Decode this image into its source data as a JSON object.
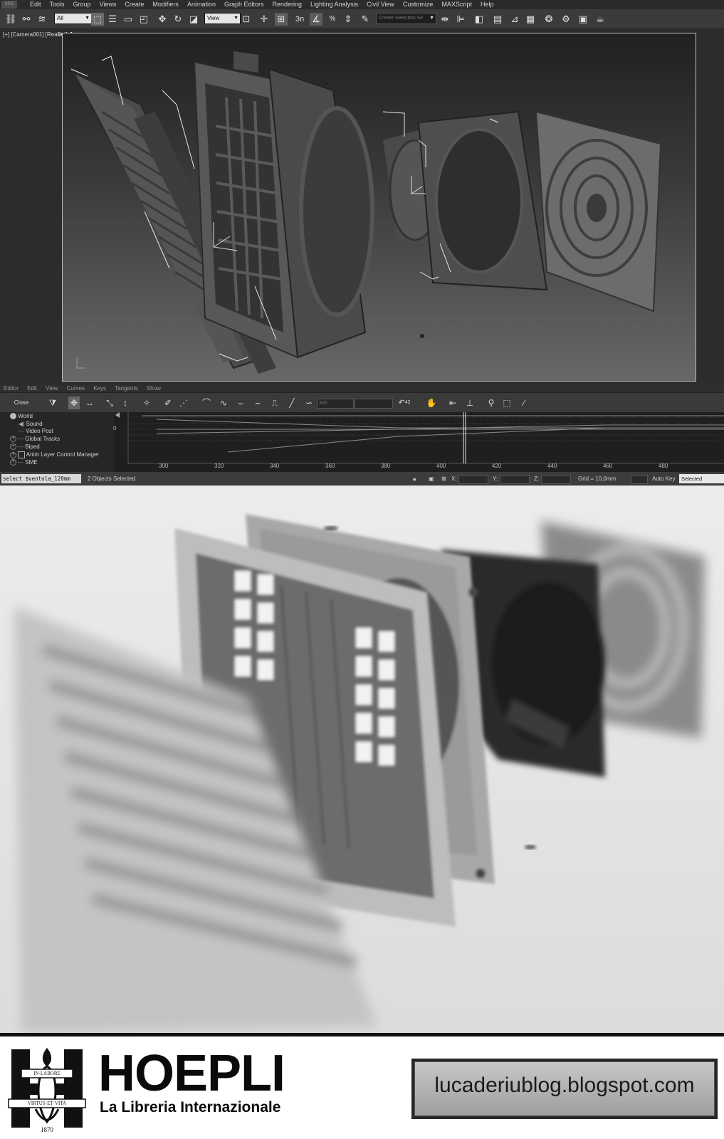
{
  "menu": {
    "items": [
      "Edit",
      "Tools",
      "Group",
      "Views",
      "Create",
      "Modifiers",
      "Animation",
      "Graph Editors",
      "Rendering",
      "Lighting Analysis",
      "Civil View",
      "Customize",
      "MAXScript",
      "Help"
    ]
  },
  "toolbar": {
    "selection_filter": "All",
    "reference_coord": "View",
    "selection_set_placeholder": "Create Selection Se",
    "icons": [
      "link-icon",
      "unlink-icon",
      "bind-space-warp-icon",
      "select-object-icon",
      "select-by-name-icon",
      "rect-region-icon",
      "window-crossing-icon",
      "move-icon",
      "rotate-icon",
      "scale-icon",
      "pivot-icon",
      "snap-icon",
      "angle-snap-icon",
      "percent-snap-icon",
      "spinner-snap-icon",
      "edit-named-sets-icon",
      "mirror-icon",
      "align-icon",
      "layer-icon",
      "ribbon-icon",
      "curve-editor-icon",
      "schematic-icon",
      "material-editor-icon",
      "render-setup-icon",
      "rendered-frame-icon",
      "render-icon"
    ],
    "snap_label": "3n"
  },
  "viewport": {
    "label_prefix": "[+] [Camera001] [Rea",
    "label_suffix": "listic]"
  },
  "curve_editor": {
    "menu": [
      "Editor",
      "Edit",
      "View",
      "Curves",
      "Keys",
      "Tangents",
      "Show"
    ],
    "close_label": "Close",
    "frame_field": "300",
    "value_readout": "42",
    "tracks": [
      "World",
      "Sound",
      "Video Post",
      "Global Tracks",
      "Biped",
      "Anim Layer Control Manager",
      "SME"
    ],
    "value_zero": "0",
    "ruler": [
      "300",
      "320",
      "340",
      "360",
      "380",
      "400",
      "420",
      "440",
      "460",
      "480"
    ]
  },
  "status_bar": {
    "script_listener": "select $ventola_120mm",
    "selection_status": "2 Objects Selected",
    "x_label": "X:",
    "y_label": "Y:",
    "z_label": "Z:",
    "grid": "Grid = 10,0mm",
    "auto_key": "Auto Key",
    "selected": "Selected"
  },
  "branding": {
    "name": "HOEPLI",
    "tagline": "La Libreria Internazionale",
    "motto_top": "IN·LABORE",
    "motto_bottom": "VIRTUS·ET·VITA",
    "year": "1870",
    "blog": "lucaderiublog.blogspot.com"
  }
}
